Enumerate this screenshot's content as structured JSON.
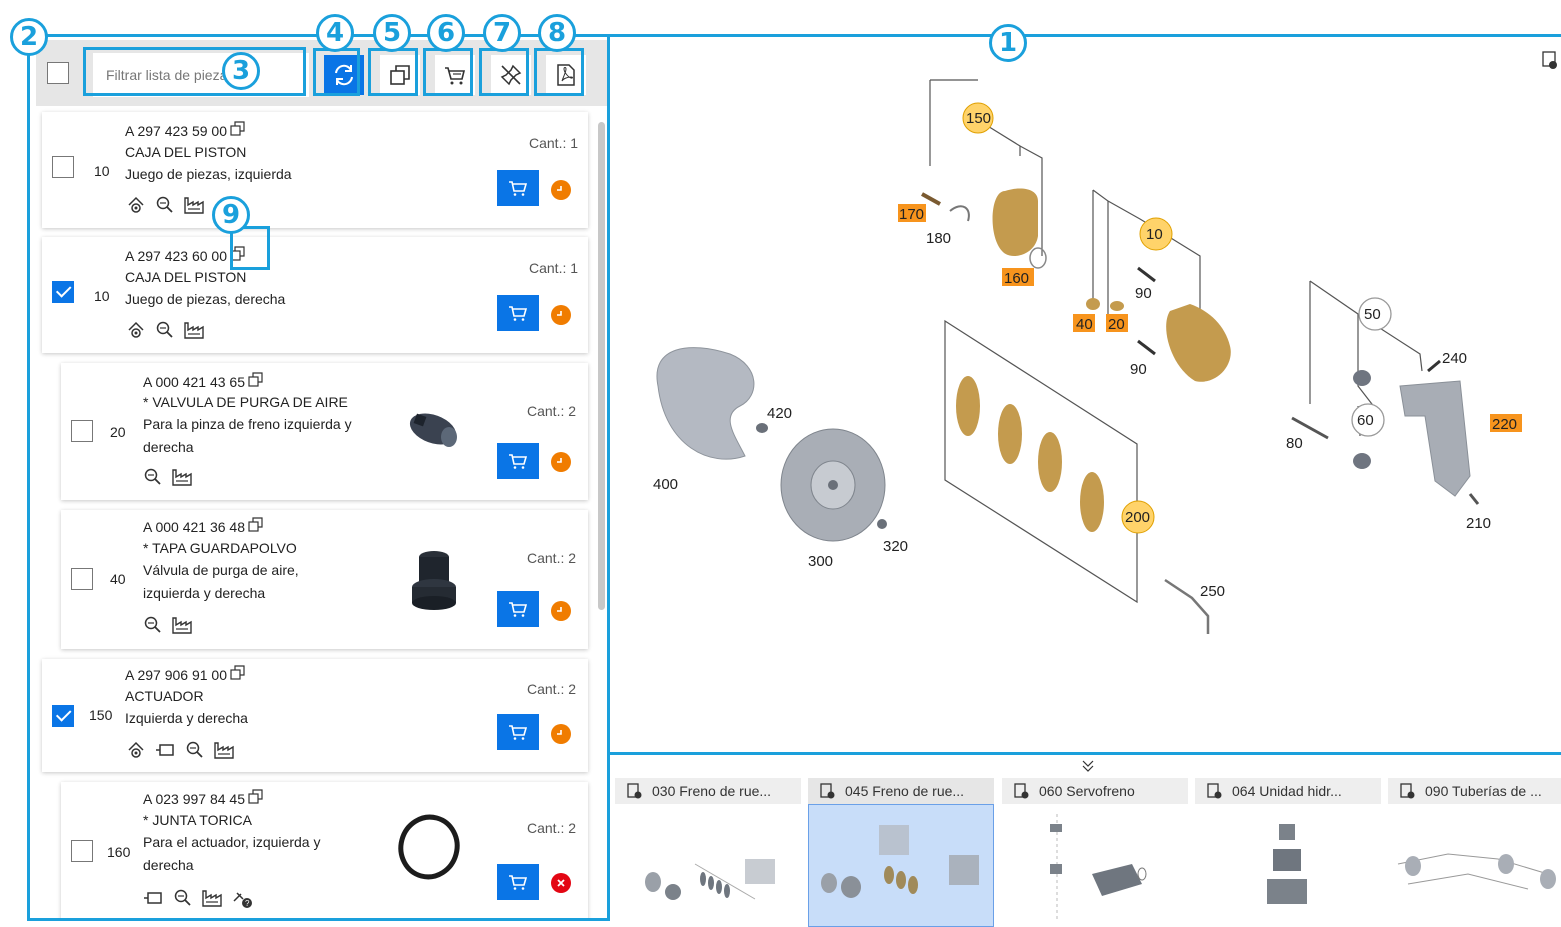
{
  "toolbar": {
    "filter_placeholder": "Filtrar lista de piezas"
  },
  "parts": [
    {
      "pos": "10",
      "number": "A 297 423 59 00",
      "name": "CAJA DEL PISTON",
      "desc": [
        "Juego de piezas, izquierda"
      ],
      "qty": "Cant.: 1",
      "checked": false,
      "status": "clock",
      "icons": [
        "gear-lupe-icon",
        "magnifier-icon",
        "factory-icon"
      ]
    },
    {
      "pos": "10",
      "number": "A 297 423 60 00",
      "name": "CAJA DEL PISTON",
      "desc": [
        "Juego de piezas, derecha"
      ],
      "qty": "Cant.: 1",
      "checked": true,
      "status": "clock",
      "icons": [
        "gear-lupe-icon",
        "magnifier-icon",
        "factory-icon"
      ]
    },
    {
      "pos": "20",
      "number": "A 000 421 43 65",
      "name": "* VALVULA DE PURGA DE AIRE",
      "desc": [
        "Para la pinza de freno izquierda y",
        "derecha"
      ],
      "qty": "Cant.: 2",
      "checked": false,
      "status": "clock",
      "icons": [
        "magnifier-icon",
        "factory-icon"
      ]
    },
    {
      "pos": "40",
      "number": "A 000 421 36 48",
      "name": "* TAPA GUARDAPOLVO",
      "desc": [
        "Válvula de purga de aire,",
        "izquierda y derecha"
      ],
      "qty": "Cant.: 2",
      "checked": false,
      "status": "clock",
      "icons": [
        "magnifier-icon",
        "factory-icon"
      ]
    },
    {
      "pos": "150",
      "number": "A 297 906 91 00",
      "name": "ACTUADOR",
      "desc": [
        "Izquierda y derecha"
      ],
      "qty": "Cant.: 2",
      "checked": true,
      "status": "clock",
      "icons": [
        "gear-lupe-icon",
        "connector-icon",
        "magnifier-icon",
        "factory-icon"
      ]
    },
    {
      "pos": "160",
      "number": "A 023 997 84 45",
      "name": "* JUNTA TORICA",
      "desc": [
        "Para el actuador, izquierda y",
        "derecha"
      ],
      "qty": "Cant.: 2",
      "checked": false,
      "status": "error",
      "icons": [
        "connector-icon",
        "magnifier-icon",
        "factory-icon",
        "cable-question-icon"
      ]
    }
  ],
  "callouts": [
    "1",
    "2",
    "3",
    "4",
    "5",
    "6",
    "7",
    "8",
    "9"
  ],
  "diagram_labels": {
    "l150": "150",
    "l170": "170",
    "l180": "180",
    "l160": "160",
    "l10": "10",
    "l90a": "90",
    "l40": "40",
    "l20": "20",
    "l90b": "90",
    "l50": "50",
    "l240": "240",
    "l60": "60",
    "l80": "80",
    "l220": "220",
    "l210": "210",
    "l420": "420",
    "l400": "400",
    "l300": "300",
    "l320": "320",
    "l200": "200",
    "l250": "250"
  },
  "tabs": [
    {
      "label": "030 Freno de rue...",
      "active": false
    },
    {
      "label": "045 Freno de rue...",
      "active": true
    },
    {
      "label": "060 Servofreno",
      "active": false
    },
    {
      "label": "064 Unidad hidr...",
      "active": false
    },
    {
      "label": "090 Tuberías de ...",
      "active": false
    }
  ],
  "colors": {
    "accent": "#1aa0dc",
    "primary": "#0a75e6",
    "highlight": "#f7941d",
    "clock": "#f07c00",
    "error": "#e30613",
    "active_tab": "#c8ddf9"
  }
}
